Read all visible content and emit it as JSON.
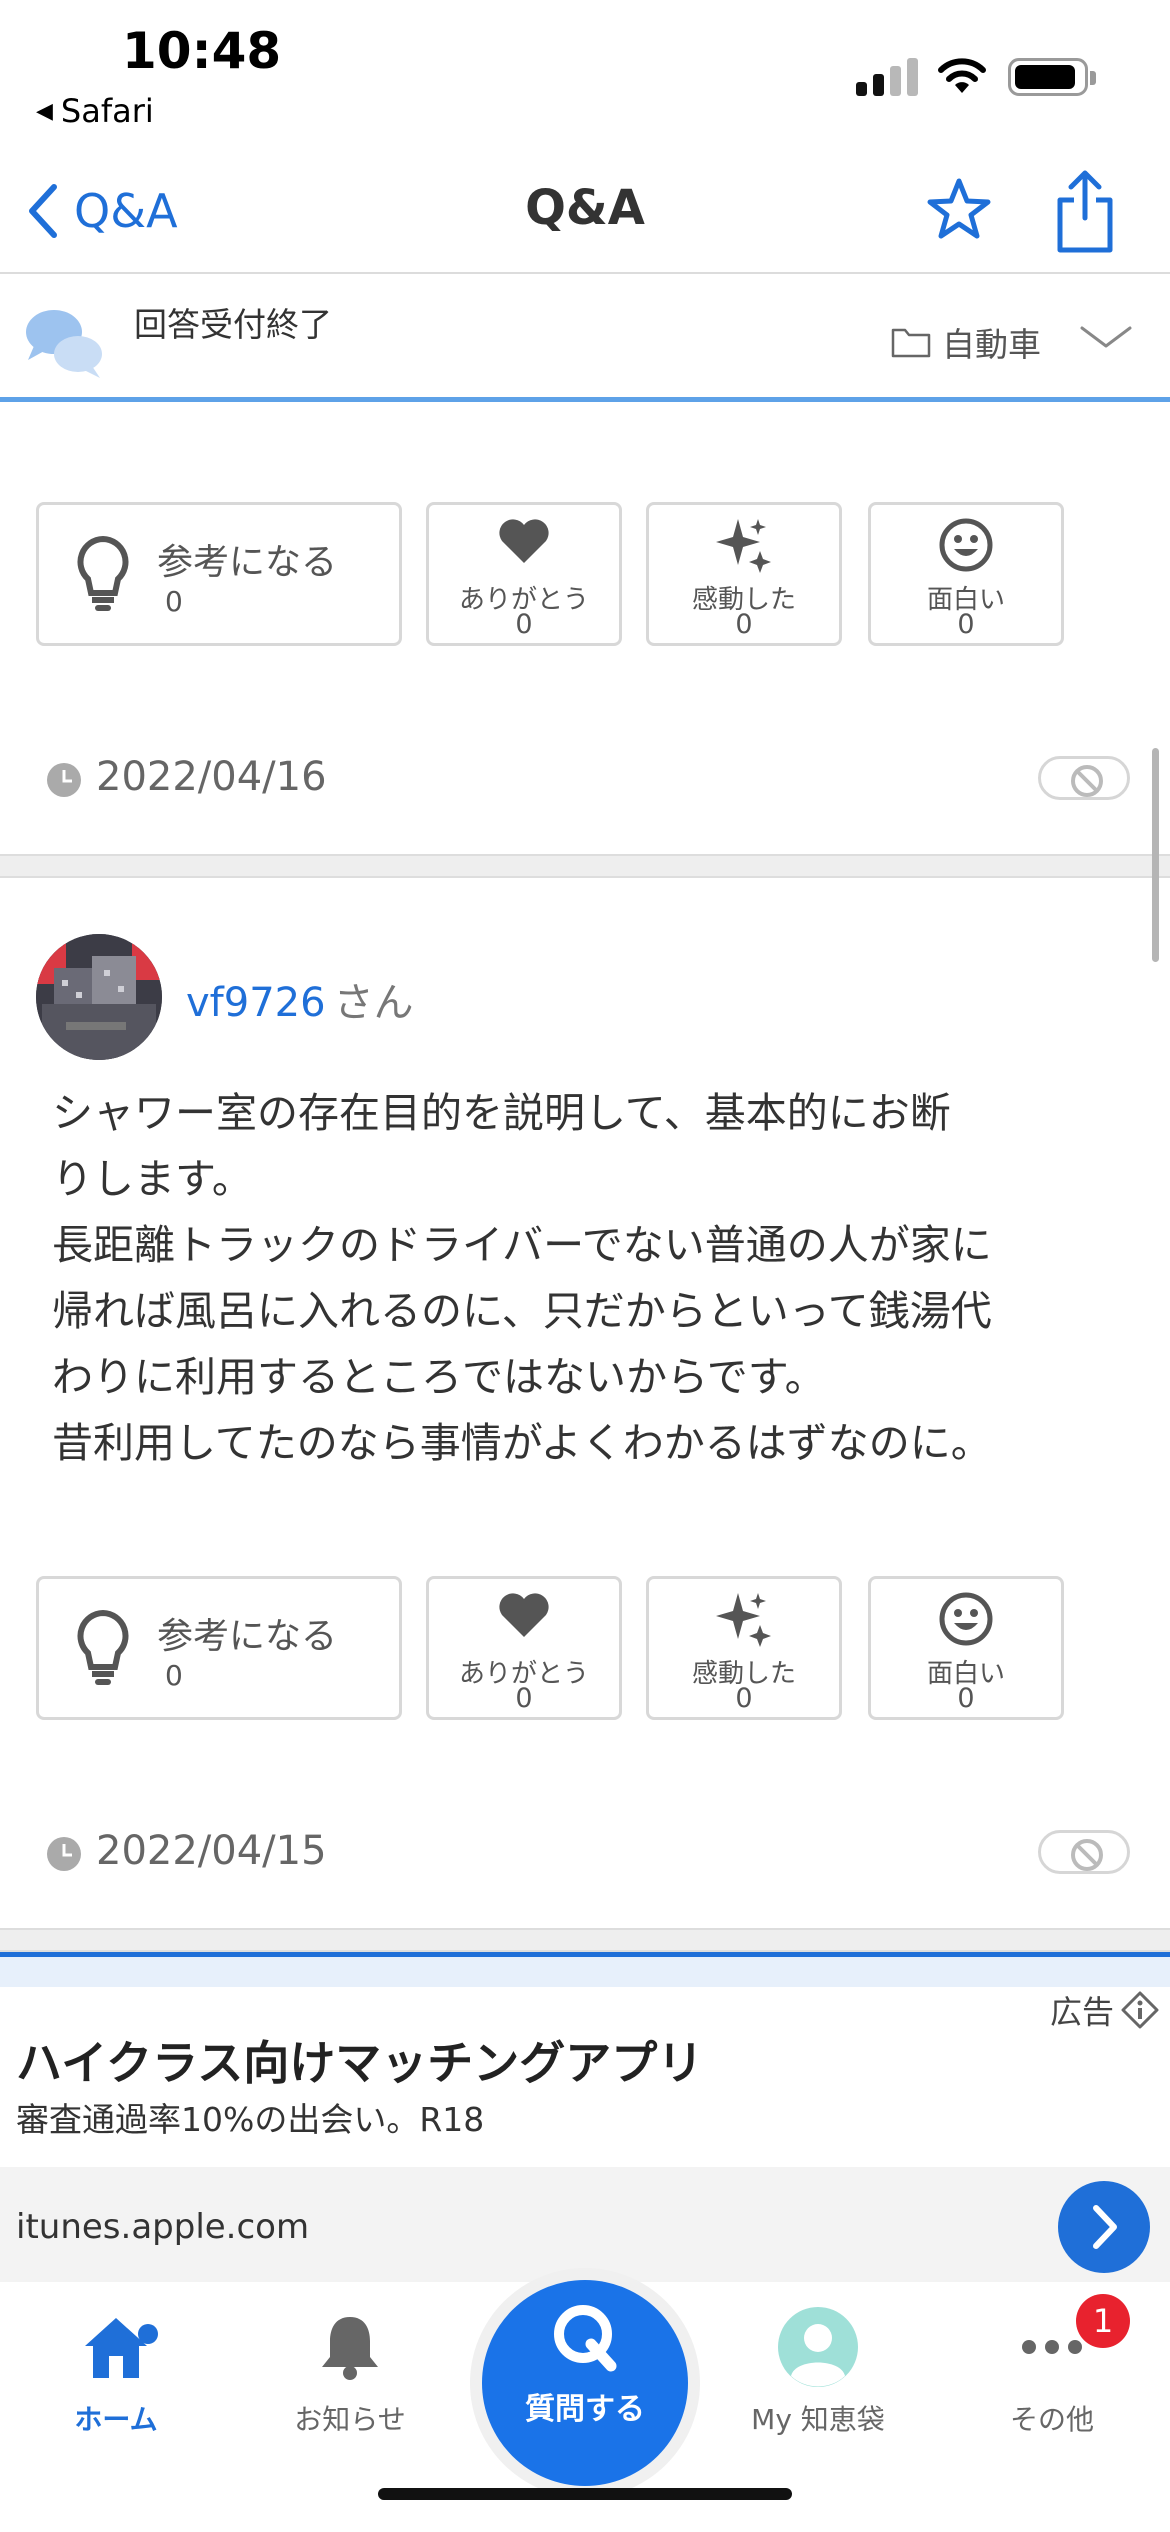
{
  "status_bar": {
    "time": "10:48",
    "back_app": "Safari"
  },
  "nav": {
    "back_label": "Q&A",
    "title": "Q&A"
  },
  "question_status": {
    "status": "回答受付終了",
    "category": "自動車"
  },
  "reactions": [
    {
      "label": "参考になる",
      "count": "0"
    },
    {
      "label": "ありがとう",
      "count": "0"
    },
    {
      "label": "感動した",
      "count": "0"
    },
    {
      "label": "面白い",
      "count": "0"
    }
  ],
  "prev_answer": {
    "date": "2022/04/16"
  },
  "answer": {
    "username": "vf9726",
    "honorific": "さん",
    "body_lines": [
      "シャワー室の存在目的を説明して、基本的にお断",
      "りします。",
      "長距離トラックのドライバーでない普通の人が家に",
      "帰れば風呂に入れるのに、只だからといって銭湯代",
      "わりに利用するところではないからです。",
      "昔利用してたのなら事情がよくわかるはずなのに。"
    ],
    "date": "2022/04/15"
  },
  "ad": {
    "label": "広告",
    "title": "ハイクラス向けマッチングアプリ",
    "description": "審査通過率10%の出会い。R18",
    "url": "itunes.apple.com"
  },
  "tabbar": {
    "home": "ホーム",
    "notify": "お知らせ",
    "ask": "質問する",
    "mychie": "My 知恵袋",
    "more": "その他",
    "more_badge": "1"
  },
  "colors": {
    "accent": "#1f6fd8",
    "badge": "#e8222e"
  }
}
